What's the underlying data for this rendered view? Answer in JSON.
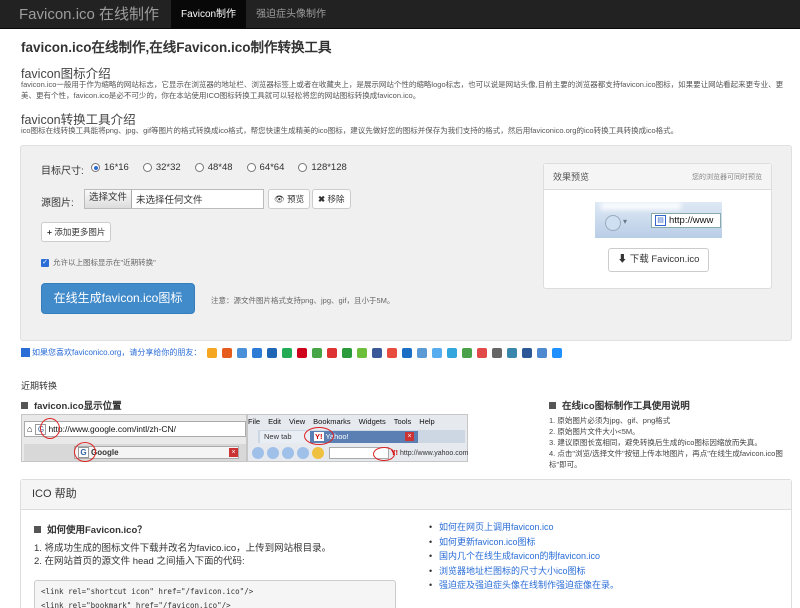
{
  "nav": {
    "brand": "Favicon.ico 在线制作",
    "items": [
      "Favicon制作",
      "强迫症头像制作"
    ]
  },
  "page_title": "favicon.ico在线制作,在线Favicon.ico制作转换工具",
  "intro": {
    "title": "favicon图标介绍",
    "text": "favicon.ico一般用于作为缩略的网站标志，它显示在浏览器的地址栏、浏览器标签上或者在收藏夹上，是展示网站个性的缩略logo标志，也可以说是网站头像,目前主要的浏览器都支持favicon.ico图标，如果要让网站看起来更专业、更美、更有个性，favicon.ico是必不可少的，你在本站使用ICO图标转换工具就可以轻松将您的网站图标转换成favicon.ico。"
  },
  "tool": {
    "title": "favicon转换工具介绍",
    "text": "ico图标在线转换工具能将png、jpg、gif等图片的格式转换成ico格式，帮您快速生成精美的ico图标，建议先做好您的图标并保存为我们支持的格式，然后用faviconico.org的ico转换工具转换成ico格式。"
  },
  "form": {
    "size_label": "目标尺寸:",
    "sizes": [
      "16*16",
      "32*32",
      "48*48",
      "64*64",
      "128*128"
    ],
    "selected_size": "16*16",
    "source_label": "源图片:",
    "file_button": "选择文件",
    "file_status": "未选择任何文件",
    "preview_button": "预览",
    "remove_button": "移除",
    "add_more_button": "添加更多图片",
    "allow_recent_label": "允许以上图标显示在\"近期转换\"",
    "allow_recent_checked": true,
    "generate_button": "在线生成favicon.ico图标",
    "note": "注意：源文件图片格式支持png、jpg、gif，且小于5M。"
  },
  "preview": {
    "title": "效果预览",
    "hint": "您的浏览器可同时预览",
    "address": "http://www",
    "download_button": "下载 Favicon.ico"
  },
  "share": {
    "text": "如果您喜欢faviconico.org，请分享给你的朋友：",
    "icon_colors": [
      "#f5a623",
      "#e65c1c",
      "#4a90d9",
      "#2e7bd6",
      "#1f66b5",
      "#22aa55",
      "#d0021b",
      "#46a546",
      "#dd3333",
      "#2a9a3a",
      "#6cbf3b",
      "#3b5998",
      "#e84c3d",
      "#1a6fc4",
      "#5b9bd5",
      "#55acee",
      "#33a6dd",
      "#4aa14a",
      "#e24a4a",
      "#666666",
      "#3a87ad",
      "#2b5797",
      "#4f8ad1",
      "#1e90ff"
    ]
  },
  "recent_label": "近期转换",
  "left_section": {
    "title": "favicon.ico显示位置",
    "mock1_url": "http://www.google.com/intl/zh-CN/",
    "mock1_tab": "Google",
    "mock2_menu": [
      "File",
      "Edit",
      "View",
      "Bookmarks",
      "Widgets",
      "Tools",
      "Help"
    ],
    "mock2_tab1": "New tab",
    "mock2_tab2": "Yahoo!",
    "mock2_url": "http://www.yahoo.com"
  },
  "right_section": {
    "title": "在线ico图标制作工具使用说明",
    "steps": [
      "1. 原始图片必须为jpg、gif、png格式",
      "2. 原始图片文件大小<5M。",
      "3. 建议原图长宽相同，避免转换后生成的ico图标因缩放而失真。",
      "4. 点击\"浏览/选择文件\"按钮上传本地图片，再点\"在线生成favicon.ico图标\"即可。"
    ]
  },
  "help": {
    "title": "ICO 帮助",
    "question": "如何使用Favicon.ico？",
    "steps": [
      "1. 将成功生成的图标文件下载并改名为favico.ico，上传到网站根目录。",
      "2. 在网站首页的源文件 head 之间插入下面的代码:"
    ],
    "code_lines": [
      "<link rel=\"shortcut icon\" href=\"/favicon.ico\"/>",
      "<link rel=\"bookmark\" href=\"/favicon.ico\"/>"
    ],
    "links": [
      "如何在网页上调用favicon.ico",
      "如何更新favicon.ico图标",
      "国内几个在线生成favicon的制favicon.ico",
      "浏览器地址栏图标的尺寸大小ico图标",
      "强迫症及强迫症头像在线制作强迫症像在录。"
    ]
  }
}
